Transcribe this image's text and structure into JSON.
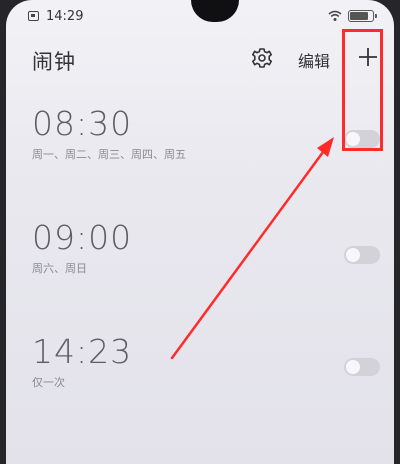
{
  "status_bar": {
    "time": "14:29",
    "battery_level": 0.85
  },
  "header": {
    "title": "闹钟",
    "settings_icon": "gear-icon",
    "edit_label": "编辑",
    "add_icon": "plus-icon"
  },
  "alarms": [
    {
      "time": "08:30",
      "repeat": "周一、周二、周三、周四、周五",
      "enabled": false
    },
    {
      "time": "09:00",
      "repeat": "周六、周日",
      "enabled": false
    },
    {
      "time": "14:23",
      "repeat": "仅一次",
      "enabled": false
    }
  ],
  "annotation": {
    "highlight_color": "#ff2a2a",
    "arrow_color": "#ff2a2a"
  }
}
